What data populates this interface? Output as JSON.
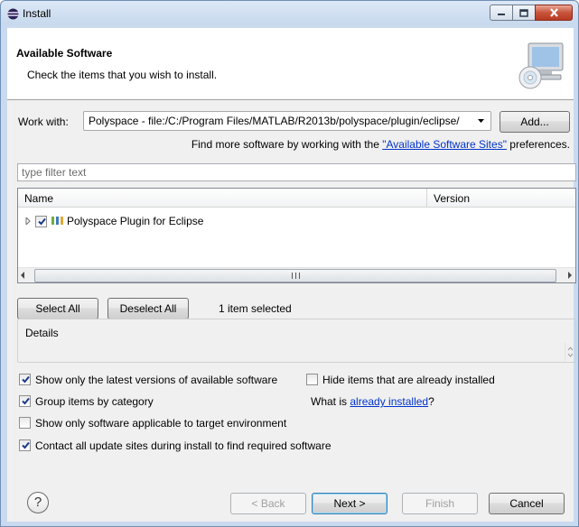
{
  "window": {
    "title": "Install"
  },
  "banner": {
    "title": "Available Software",
    "description": "Check the items that you wish to install."
  },
  "work_with": {
    "label": "Work with:",
    "value": "Polyspace - file:/C:/Program Files/MATLAB/R2013b/polyspace/plugin/eclipse/",
    "add_button": "Add...",
    "find_more_prefix": "Find more software by working with the",
    "find_more_link": "\"Available Software Sites\"",
    "find_more_suffix": "preferences."
  },
  "filter": {
    "placeholder": "type filter text"
  },
  "tree": {
    "columns": [
      "Name",
      "Version"
    ],
    "items": [
      {
        "label": "Polyspace Plugin for Eclipse",
        "checked": true,
        "version": ""
      }
    ]
  },
  "selection": {
    "select_all": "Select All",
    "deselect_all": "Deselect All",
    "status": "1 item selected"
  },
  "details": {
    "title": "Details"
  },
  "options": {
    "latest_versions": {
      "label": "Show only the latest versions of available software",
      "checked": true
    },
    "hide_installed": {
      "label": "Hide items that are already installed",
      "checked": false
    },
    "group_by_category": {
      "label": "Group items by category",
      "checked": true
    },
    "what_is_prefix": "What is",
    "already_installed_link": "already installed",
    "what_is_suffix": "?",
    "applicable_only": {
      "label": "Show only software applicable to target environment",
      "checked": false
    },
    "contact_sites": {
      "label": "Contact all update sites during install to find required software",
      "checked": true
    }
  },
  "footer": {
    "help": "?",
    "back": "< Back",
    "next": "Next >",
    "finish": "Finish",
    "cancel": "Cancel"
  }
}
